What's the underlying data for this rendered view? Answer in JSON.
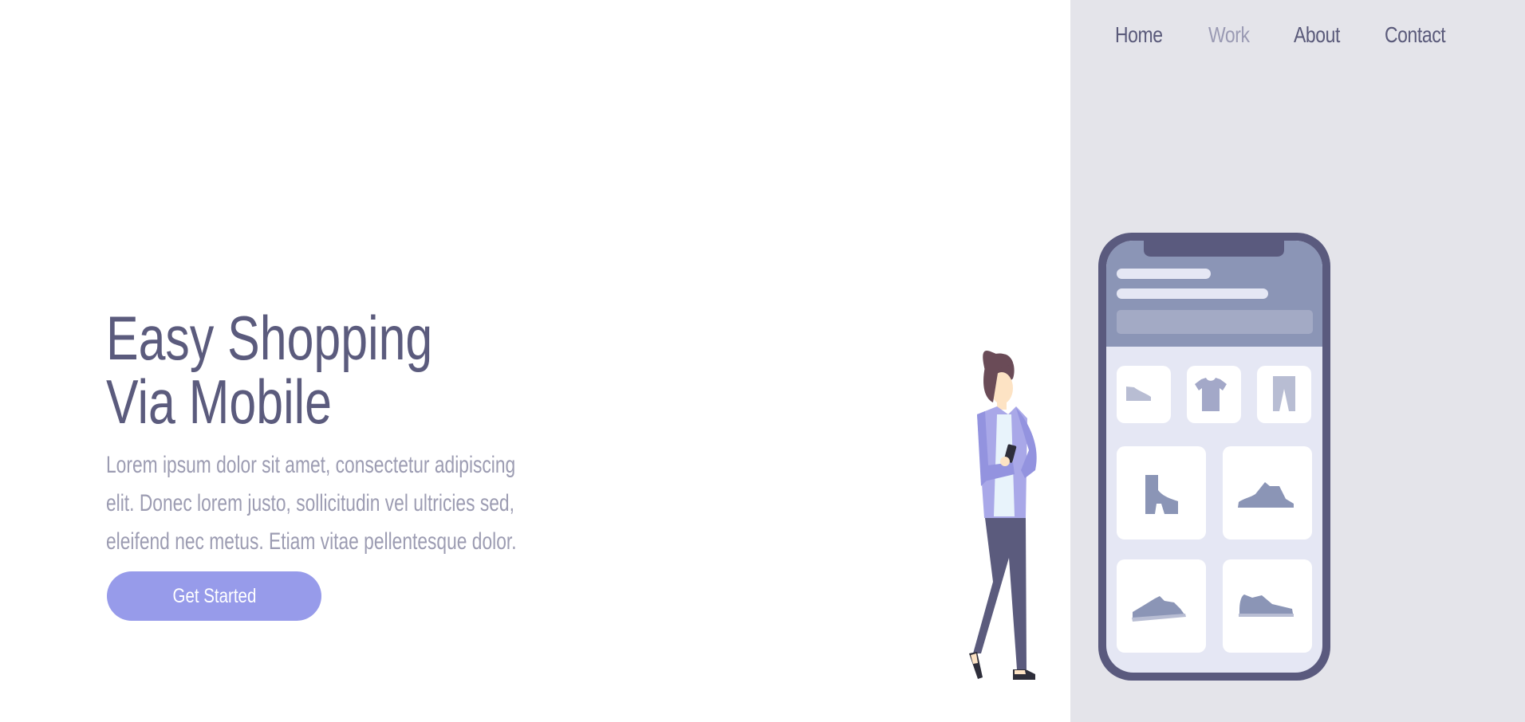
{
  "nav": {
    "items": [
      {
        "label": "Home",
        "active": false
      },
      {
        "label": "Work",
        "active": true
      },
      {
        "label": "About",
        "active": false
      },
      {
        "label": "Contact",
        "active": false
      }
    ]
  },
  "hero": {
    "title_line1": "Easy Shopping",
    "title_line2": "Via Mobile",
    "description": "Lorem ipsum dolor sit amet, consectetur adipiscing elit. Donec lorem justo, sollicitudin vel ultricies sed, eleifend nec metus. Etiam vitae pellentesque dolor.",
    "cta_label": "Get Started"
  },
  "colors": {
    "primary_text": "#5b5b7d",
    "muted_text": "#9c9cb2",
    "accent": "#979bea",
    "panel_bg": "#e4e4ea",
    "phone_frame": "#5a5a7e"
  },
  "illustration": {
    "icons": [
      "shoe-icon",
      "tshirt-icon",
      "pants-icon",
      "boot-icon",
      "sneaker-icon",
      "sneaker-icon",
      "sneaker-icon"
    ]
  }
}
